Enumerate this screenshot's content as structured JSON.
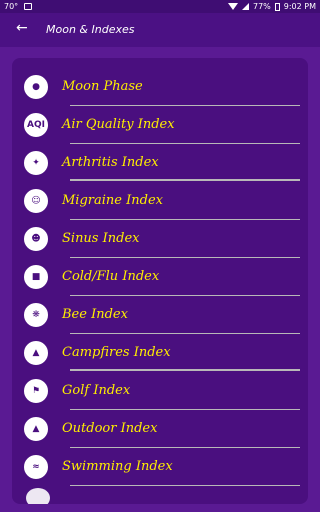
{
  "status_bar": {
    "temperature": "70°",
    "battery": "77%",
    "time": "9:02 PM"
  },
  "toolbar": {
    "back_icon": "arrow-left-icon",
    "title": "Moon & Indexes"
  },
  "items": [
    {
      "label": "Moon Phase",
      "icon": "moon-icon"
    },
    {
      "label": "Air Quality Index",
      "icon": "aqi-icon"
    },
    {
      "label": "Arthritis Index",
      "icon": "arthritis-icon"
    },
    {
      "label": "Migraine Index",
      "icon": "migraine-icon"
    },
    {
      "label": "Sinus Index",
      "icon": "sinus-icon"
    },
    {
      "label": "Cold/Flu Index",
      "icon": "cold-flu-icon"
    },
    {
      "label": "Bee Index",
      "icon": "bee-icon"
    },
    {
      "label": "Campfires Index",
      "icon": "campfire-icon"
    },
    {
      "label": "Golf Index",
      "icon": "golf-icon"
    },
    {
      "label": "Outdoor Index",
      "icon": "outdoor-icon"
    },
    {
      "label": "Swimming Index",
      "icon": "swimming-icon"
    }
  ],
  "colors": {
    "background": "#5a1a93",
    "panel": "#4a0f7f",
    "label": "#ffee00",
    "divider": "#b8b8b8"
  }
}
